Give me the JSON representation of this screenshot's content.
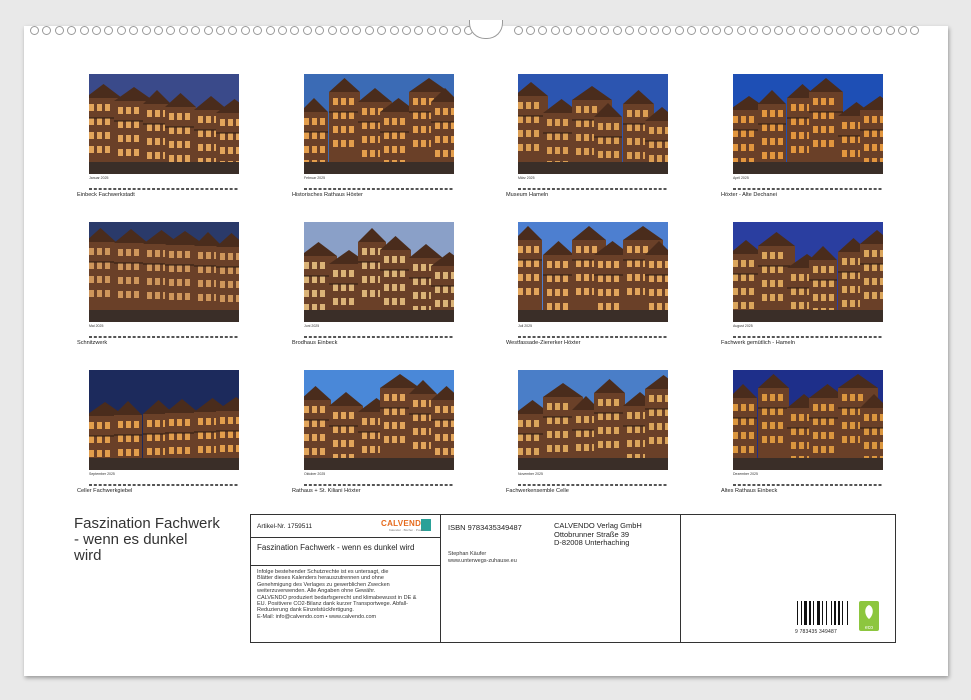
{
  "calendar_title": "Faszination Fachwerk - wenn es dunkel wird",
  "title_lines": [
    "Faszination Fachwerk",
    "- wenn es dunkel",
    "wird"
  ],
  "months": [
    {
      "month": "Januar 2025",
      "caption": "Einbeck Fachwerkstadt",
      "sky": "#3a4a8a",
      "glow": "#f0b060"
    },
    {
      "month": "Februar 2025",
      "caption": "Historisches Rathaus Höxter",
      "sky": "#3b6bb5",
      "glow": "#f2a850"
    },
    {
      "month": "März 2025",
      "caption": "Museum Hameln",
      "sky": "#2c55b0",
      "glow": "#e8a858"
    },
    {
      "month": "April 2025",
      "caption": "Höxter - Alte Dechanei",
      "sky": "#1e4fb5",
      "glow": "#f0a040"
    },
    {
      "month": "Mai 2025",
      "caption": "Schnitzwerk",
      "sky": "#2a3a6a",
      "glow": "#d9a060"
    },
    {
      "month": "Juni 2025",
      "caption": "Brodhaus Einbeck",
      "sky": "#8aa0c8",
      "glow": "#e8c080"
    },
    {
      "month": "Juli 2025",
      "caption": "Westfassade-Ziererker Höxter",
      "sky": "#4d7fd0",
      "glow": "#f0b060"
    },
    {
      "month": "August 2025",
      "caption": "Fachwerk gemütlich - Hameln",
      "sky": "#2a3ea0",
      "glow": "#e8b060"
    },
    {
      "month": "September 2025",
      "caption": "Celler Fachwerkgiebel",
      "sky": "#1c2a5c",
      "glow": "#f0a850"
    },
    {
      "month": "Oktober 2025",
      "caption": "Rathaus + St. Kiliani Höxter",
      "sky": "#4a88d8",
      "glow": "#f0b060"
    },
    {
      "month": "November 2025",
      "caption": "Fachwerkensemble Celle",
      "sky": "#4a7ec8",
      "glow": "#e8b060"
    },
    {
      "month": "Dezember 2025",
      "caption": "Altes Rathaus Einbeck",
      "sky": "#1e2f8a",
      "glow": "#e8a040"
    }
  ],
  "info": {
    "article": "Artikel-Nr. 1759511",
    "logo_text": "CALVENDO",
    "logo_sub": "Kalender · Bücher · Poster",
    "product_title": "Faszination Fachwerk - wenn es dunkel wird",
    "legal_lines": [
      "Infolge bestehender Schutzrechte ist es untersagt, die",
      "Blätter dieses Kalenders herauszutrennen und ohne",
      "Genehmigung des Verlages zu gewerblichen Zwecken",
      "weiterzuverwenden. Alle Angaben ohne Gewähr.",
      "CALVENDO produziert bedarfsgerecht und klimabewusst in DE &",
      "EU. Positivere CO2-Bilanz dank kurzer Transportwege. Abfall-",
      "Reduzierung dank Einzelstückfertigung.",
      "E-Mail: info@calvendo.com • www.calvendo.com"
    ],
    "isbn": "ISBN 9783435349487",
    "author": "Stephan Käufer",
    "author_url": "www.unterwegs-zuhause.eu",
    "publisher_lines": [
      "CALVENDO Verlag GmbH",
      "Ottobrunner Straße 39",
      "D-82008 Unterhaching"
    ],
    "barcode_digits": "9 783435 349487",
    "eco_label": "eco"
  }
}
